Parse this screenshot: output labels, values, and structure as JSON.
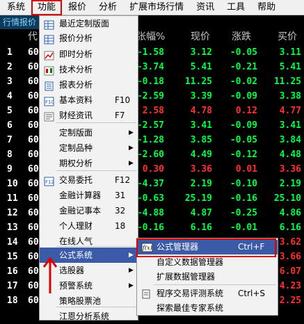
{
  "menubar": [
    "系统",
    "功能",
    "报价",
    "分析",
    "扩展市场行情",
    "资讯",
    "工具",
    "帮助"
  ],
  "tab_label": "行情报价",
  "headers": {
    "code": "代",
    "change_pct": "张幅%",
    "price": "现价",
    "change": "涨跌",
    "bid": "买价"
  },
  "rows": [
    {
      "idx": "1",
      "code": "60",
      "pct": "-1.58",
      "price": "3.12",
      "chg": "-0.05",
      "bid": "3.11"
    },
    {
      "idx": "2",
      "code": "60",
      "pct": "-3.74",
      "price": "5.41",
      "chg": "-0.21",
      "bid": "5.41"
    },
    {
      "idx": "3",
      "code": "60",
      "pct": "-0.18",
      "price": "11.25",
      "chg": "-0.02",
      "bid": "11.25"
    },
    {
      "idx": "4",
      "code": "60",
      "pct": "-2.59",
      "price": "3.39",
      "chg": "-0.09",
      "bid": "3.38"
    },
    {
      "idx": "5",
      "code": "60",
      "pct": "2.58",
      "price": "4.78",
      "chg": "0.12",
      "bid": "4.77"
    },
    {
      "idx": "6",
      "code": "60",
      "pct": "-2.57",
      "price": "3.41",
      "chg": "-0.09",
      "bid": "3.41"
    },
    {
      "idx": "7",
      "code": "60",
      "pct": "-1.28",
      "price": "3.85",
      "chg": "-0.05",
      "bid": "3.84"
    },
    {
      "idx": "8",
      "code": "60",
      "pct": "-2.60",
      "price": "4.49",
      "chg": "-0.12",
      "bid": "4.48"
    },
    {
      "idx": "9",
      "code": "60",
      "pct": "0.30",
      "price": "3.36",
      "chg": "0.01",
      "bid": "3.36"
    },
    {
      "idx": "10",
      "code": "60",
      "pct": "-4.37",
      "price": "2.19",
      "chg": "-0.10",
      "bid": "2.19"
    },
    {
      "idx": "11",
      "code": "60",
      "pct": "-0.63",
      "price": "25.19",
      "chg": "-0.16",
      "bid": "25.10"
    },
    {
      "idx": "12",
      "code": "60",
      "pct": "-4.88",
      "price": "4.87",
      "chg": "-0.25",
      "bid": "4.86"
    },
    {
      "idx": "13",
      "code": "60",
      "pct": "-0.16",
      "price": "6.16",
      "chg": "-0.01",
      "bid": "6.16"
    },
    {
      "idx": "14",
      "code": "60",
      "pct": "",
      "price": "",
      "chg": "",
      "bid": "3.62"
    },
    {
      "idx": "15",
      "code": "60",
      "pct": "",
      "price": "",
      "chg": "",
      "bid": "3.66"
    },
    {
      "idx": "16",
      "code": "60",
      "pct": "",
      "price": "",
      "chg": "",
      "bid": "6.07"
    },
    {
      "idx": "17",
      "code": "60",
      "pct": "",
      "price": "",
      "chg": "",
      "bid": "4.23"
    },
    {
      "idx": "18",
      "code": "60",
      "pct": "",
      "price": "",
      "chg": "",
      "bid": "2.25"
    }
  ],
  "colors": {
    "down": "#00ff44",
    "up": "#ff3030",
    "highlight": "#3b5ba8",
    "annotation": "#e00000"
  },
  "main_menu": [
    {
      "label": "最近定制版面",
      "icon": "table-icon"
    },
    {
      "label": "报价分析",
      "icon": "table-icon"
    },
    {
      "label": "即时分析",
      "icon": "line-chart-icon"
    },
    {
      "label": "技术分析",
      "icon": "candlestick-icon"
    },
    {
      "label": "报表分析",
      "icon": "report-icon"
    },
    {
      "label": "基本资料",
      "icon": "f10-icon",
      "shortcut": "F10"
    },
    {
      "label": "财经资讯",
      "icon": "news-icon",
      "shortcut": "F7"
    },
    {
      "label": "定制版面",
      "submenu": true
    },
    {
      "label": "定制品种",
      "submenu": true
    },
    {
      "label": "期权分析",
      "submenu": true
    },
    {
      "label": "交易委托",
      "icon": "f12-icon",
      "shortcut": "F12"
    },
    {
      "label": "金融计算器",
      "shortcut": "31"
    },
    {
      "label": "金融记事本",
      "shortcut": "32"
    },
    {
      "label": "个人理财",
      "shortcut": "18"
    },
    {
      "label": "在线人气"
    },
    {
      "label": "公式系统",
      "submenu": true
    },
    {
      "label": "选股器",
      "submenu": true
    },
    {
      "label": "预警系统",
      "submenu": true
    },
    {
      "label": "策略股票池"
    },
    {
      "label": "江恩分析系统"
    }
  ],
  "sub_menu": [
    {
      "label": "公式管理器",
      "icon": "formula-icon",
      "shortcut": "Ctrl+F"
    },
    {
      "label": "自定义数据管理器"
    },
    {
      "label": "扩展数据管理器"
    },
    {
      "label": "程序交易评测系统",
      "icon": "doc-icon",
      "shortcut": "Ctrl+S"
    },
    {
      "label": "探索最佳专家系统"
    }
  ]
}
